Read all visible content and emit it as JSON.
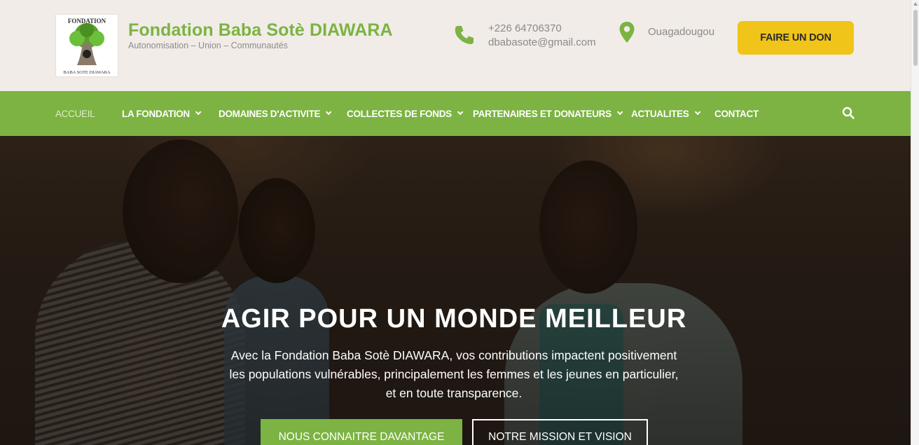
{
  "brand": {
    "name": "Fondation Baba Sotè DIAWARA",
    "tagline": "Autonomisation – Union – Communautés",
    "logo_text_top": "FONDATION",
    "logo_text_bottom": "BABA SOTE DIAWARA"
  },
  "contact": {
    "phone": "+226 64706370",
    "email": "dbabasote@gmail.com",
    "city": "Ouagadougou"
  },
  "donate_label": "FAIRE UN DON",
  "nav": {
    "items": [
      {
        "label": "ACCUEIL",
        "active": true,
        "dropdown": false
      },
      {
        "label": "LA FONDATION",
        "active": false,
        "dropdown": true
      },
      {
        "label": "DOMAINES D'ACTIVITE",
        "active": false,
        "dropdown": true
      },
      {
        "label": "COLLECTES DE FONDS",
        "active": false,
        "dropdown": true
      },
      {
        "label": "PARTENAIRES ET DONATEURS",
        "active": false,
        "dropdown": true
      },
      {
        "label": "ACTUALITES",
        "active": false,
        "dropdown": true
      },
      {
        "label": "CONTACT",
        "active": false,
        "dropdown": false
      }
    ]
  },
  "hero": {
    "title": "AGIR POUR UN MONDE MEILLEUR",
    "lines": [
      "Avec la Fondation Baba Sotè DIAWARA, vos contributions impactent positivement",
      "les populations vulnérables, principalement les femmes et les jeunes en particulier,",
      "et en toute transparence."
    ],
    "primary_button": "NOUS CONNAITRE DAVANTAGE",
    "secondary_button": "NOTRE MISSION ET VISION"
  },
  "colors": {
    "brand_green": "#7cb342",
    "donate_yellow": "#f0c419",
    "header_bg": "#f1ece7"
  },
  "icons": {
    "phone": "phone-icon",
    "location": "map-pin-icon",
    "search": "search-icon"
  }
}
